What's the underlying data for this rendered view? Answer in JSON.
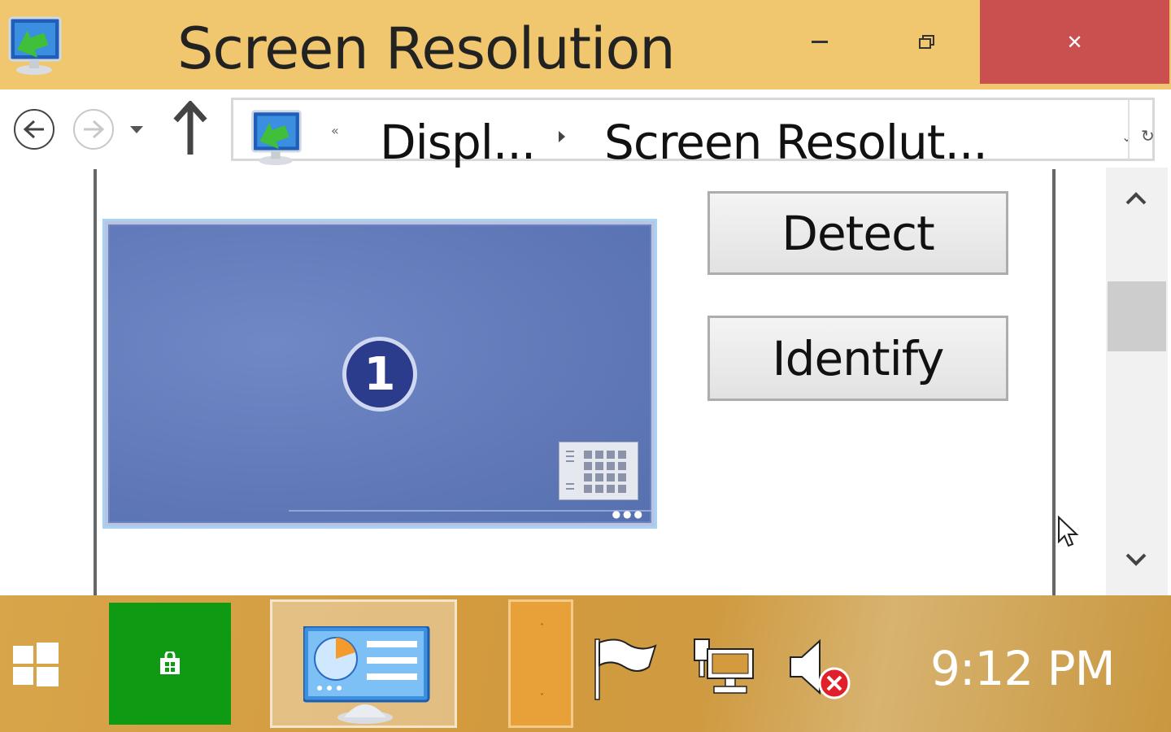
{
  "window": {
    "title": "Screen Resolution",
    "minimize_label": "–",
    "maximize_label": "🗗",
    "close_label": "✕"
  },
  "nav": {
    "breadcrumb_overflow": "«",
    "breadcrumb_parent": "Displ...",
    "breadcrumb_current": "Screen Resolut...",
    "address_dropdown": "⌄",
    "refresh": "↻"
  },
  "display": {
    "monitor_number": "1"
  },
  "buttons": {
    "detect": "Detect",
    "identify": "Identify"
  },
  "taskbar": {
    "clock": "9:12 PM",
    "orange_up": "˄",
    "orange_down": "˅"
  },
  "colors": {
    "titlebar": "#f0c76e",
    "close_button": "#c9504f",
    "store_tile": "#0e9a12",
    "monitor_fill": "#6a82c0"
  }
}
